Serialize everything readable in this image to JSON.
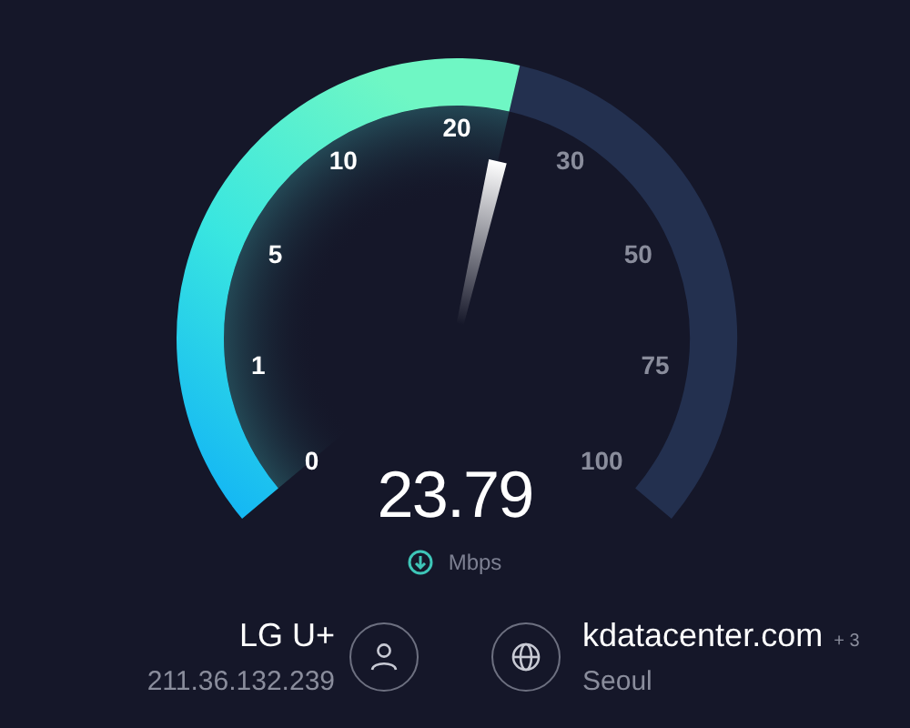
{
  "gauge": {
    "scale": [
      "0",
      "1",
      "5",
      "10",
      "20",
      "30",
      "50",
      "75",
      "100"
    ]
  },
  "reading": {
    "value": "23.79",
    "unit": "Mbps"
  },
  "provider": {
    "name": "LG U+",
    "ip": "211.36.132.239"
  },
  "server": {
    "name": "kdatacenter.com",
    "extra": "+ 3",
    "location": "Seoul"
  }
}
